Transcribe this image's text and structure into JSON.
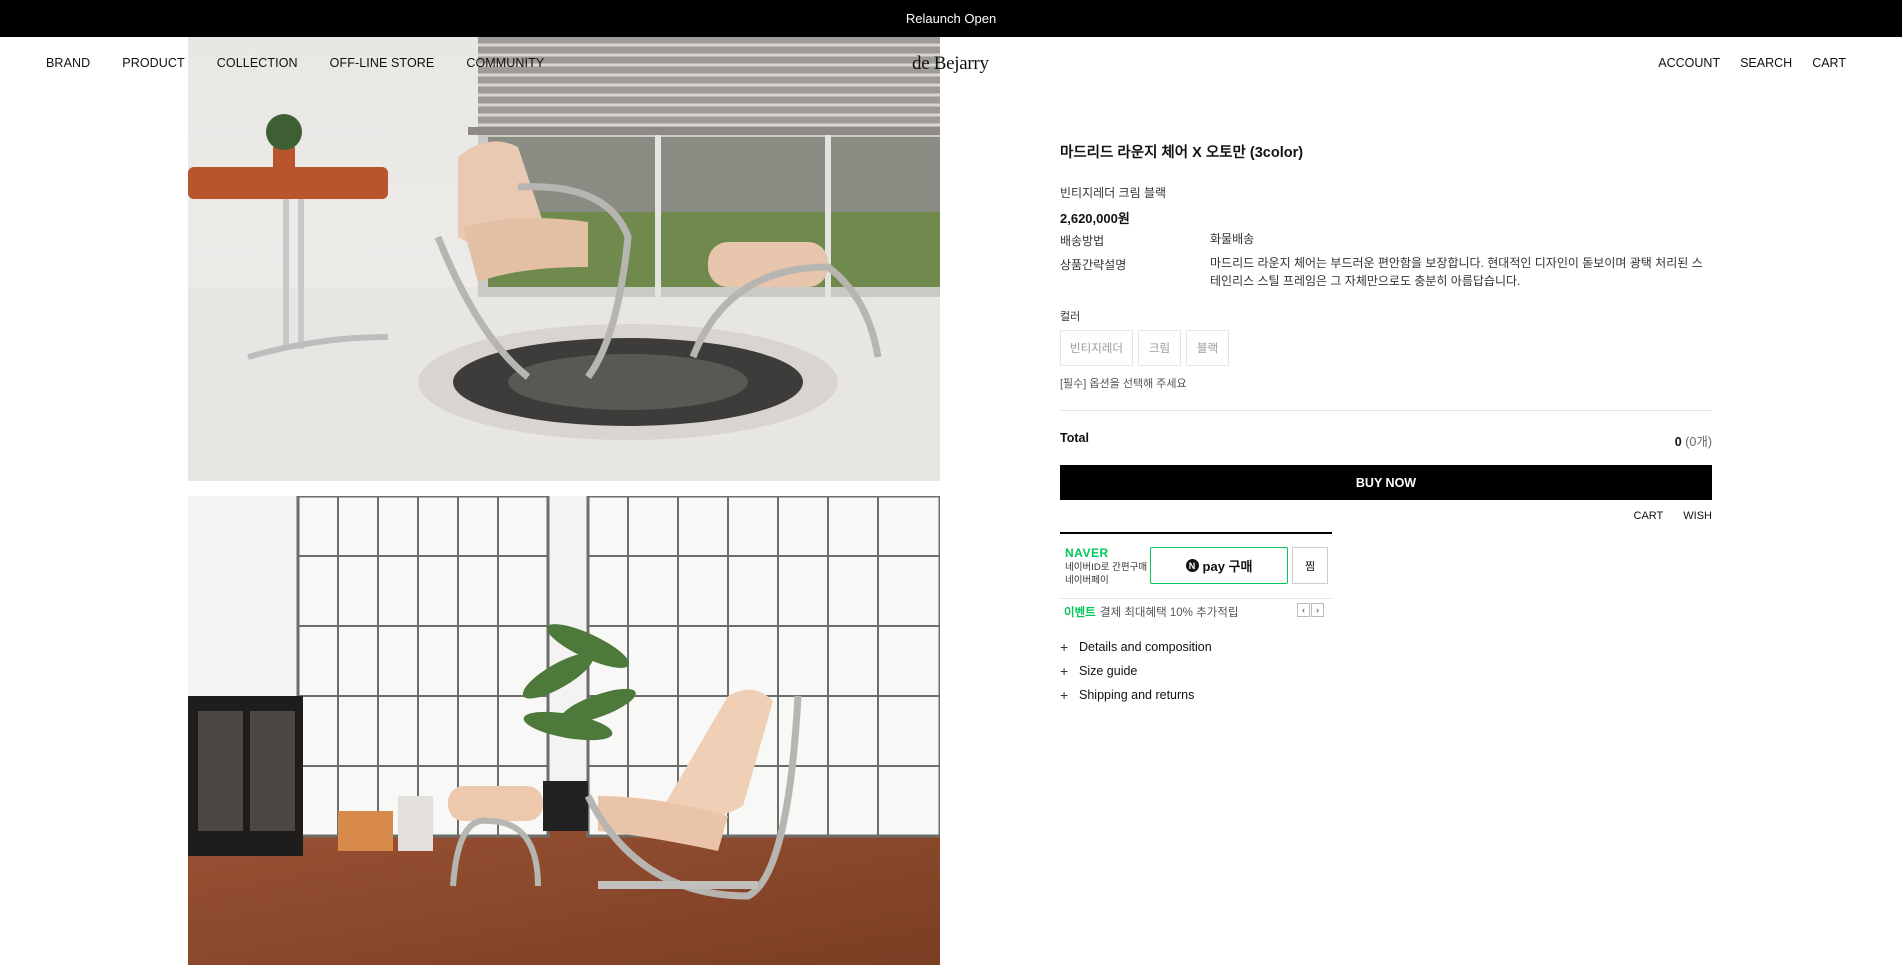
{
  "announcement": "Relaunch Open",
  "nav": {
    "left": [
      "BRAND",
      "PRODUCT",
      "COLLECTION",
      "OFF-LINE STORE",
      "COMMUNITY"
    ],
    "logo": "de Bejarry",
    "right": [
      "ACCOUNT",
      "SEARCH",
      "CART"
    ]
  },
  "product": {
    "title": "마드리드 라운지 체어 X 오토만 (3color)",
    "variant": "빈티지레더 크림 블랙",
    "price": "2,620,000원",
    "shipping_label": "배송방법",
    "shipping_value": "화물배송",
    "desc_label": "상품간략설명",
    "desc_value": "마드리드 라운지 체어는 부드러운 편안함을 보장합니다. 현대적인 디자인이 돋보이며 광택 처리된 스테인리스 스틸 프레임은 그 자체만으로도 충분히 아름답습니다.",
    "color_label": "컬러",
    "color_options": [
      "빈티지레더",
      "크림",
      "블랙"
    ],
    "required_note": "[필수] 옵션을 선택해 주세요",
    "total_label": "Total",
    "total_amount": "0",
    "total_count": "(0개)",
    "buy_now": "BUY NOW",
    "cart": "CART",
    "wish": "WISH"
  },
  "npay": {
    "brand": "NAVER",
    "sub_line1": "네이버ID로 간편구매",
    "sub_line2": "네이버페이",
    "n_mark": "N",
    "button": "pay 구매",
    "zzim": "찜",
    "event_tag": "이벤트",
    "event_text": "결제 최대혜택 10% 추가적립"
  },
  "accordion": [
    "Details and composition",
    "Size guide",
    "Shipping and returns"
  ],
  "colors": {
    "accent": "#03c75a",
    "black": "#000000"
  }
}
